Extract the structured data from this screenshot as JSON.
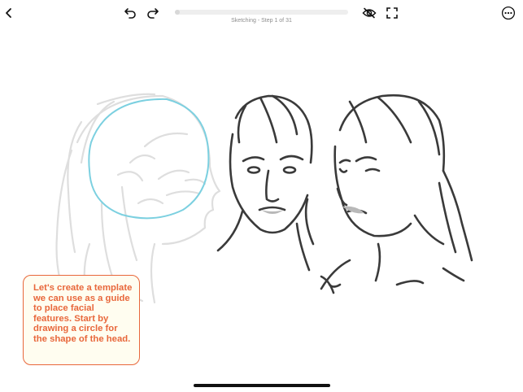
{
  "toolbar": {
    "back_icon": "chevron-left-icon",
    "undo_icon": "undo-icon",
    "redo_icon": "redo-icon",
    "visibility_icon": "eye-slash-icon",
    "fullscreen_icon": "fullscreen-icon",
    "more_icon": "ellipsis-circle-icon"
  },
  "lesson": {
    "step_label": "Sketching - Step 1 of 31",
    "current_step": 1,
    "total_steps": 31,
    "progress_fraction": 0.03
  },
  "tip": {
    "text": "Let's create a template we can use as a guide to place facial features. Start by drawing a circle for the shape of the head."
  },
  "colors": {
    "accent": "#e8673b",
    "tip_background": "#fffdf0",
    "guide_circle": "#7cd0e0",
    "trace_stroke": "#dedede",
    "ink": "#3a3a3a"
  }
}
